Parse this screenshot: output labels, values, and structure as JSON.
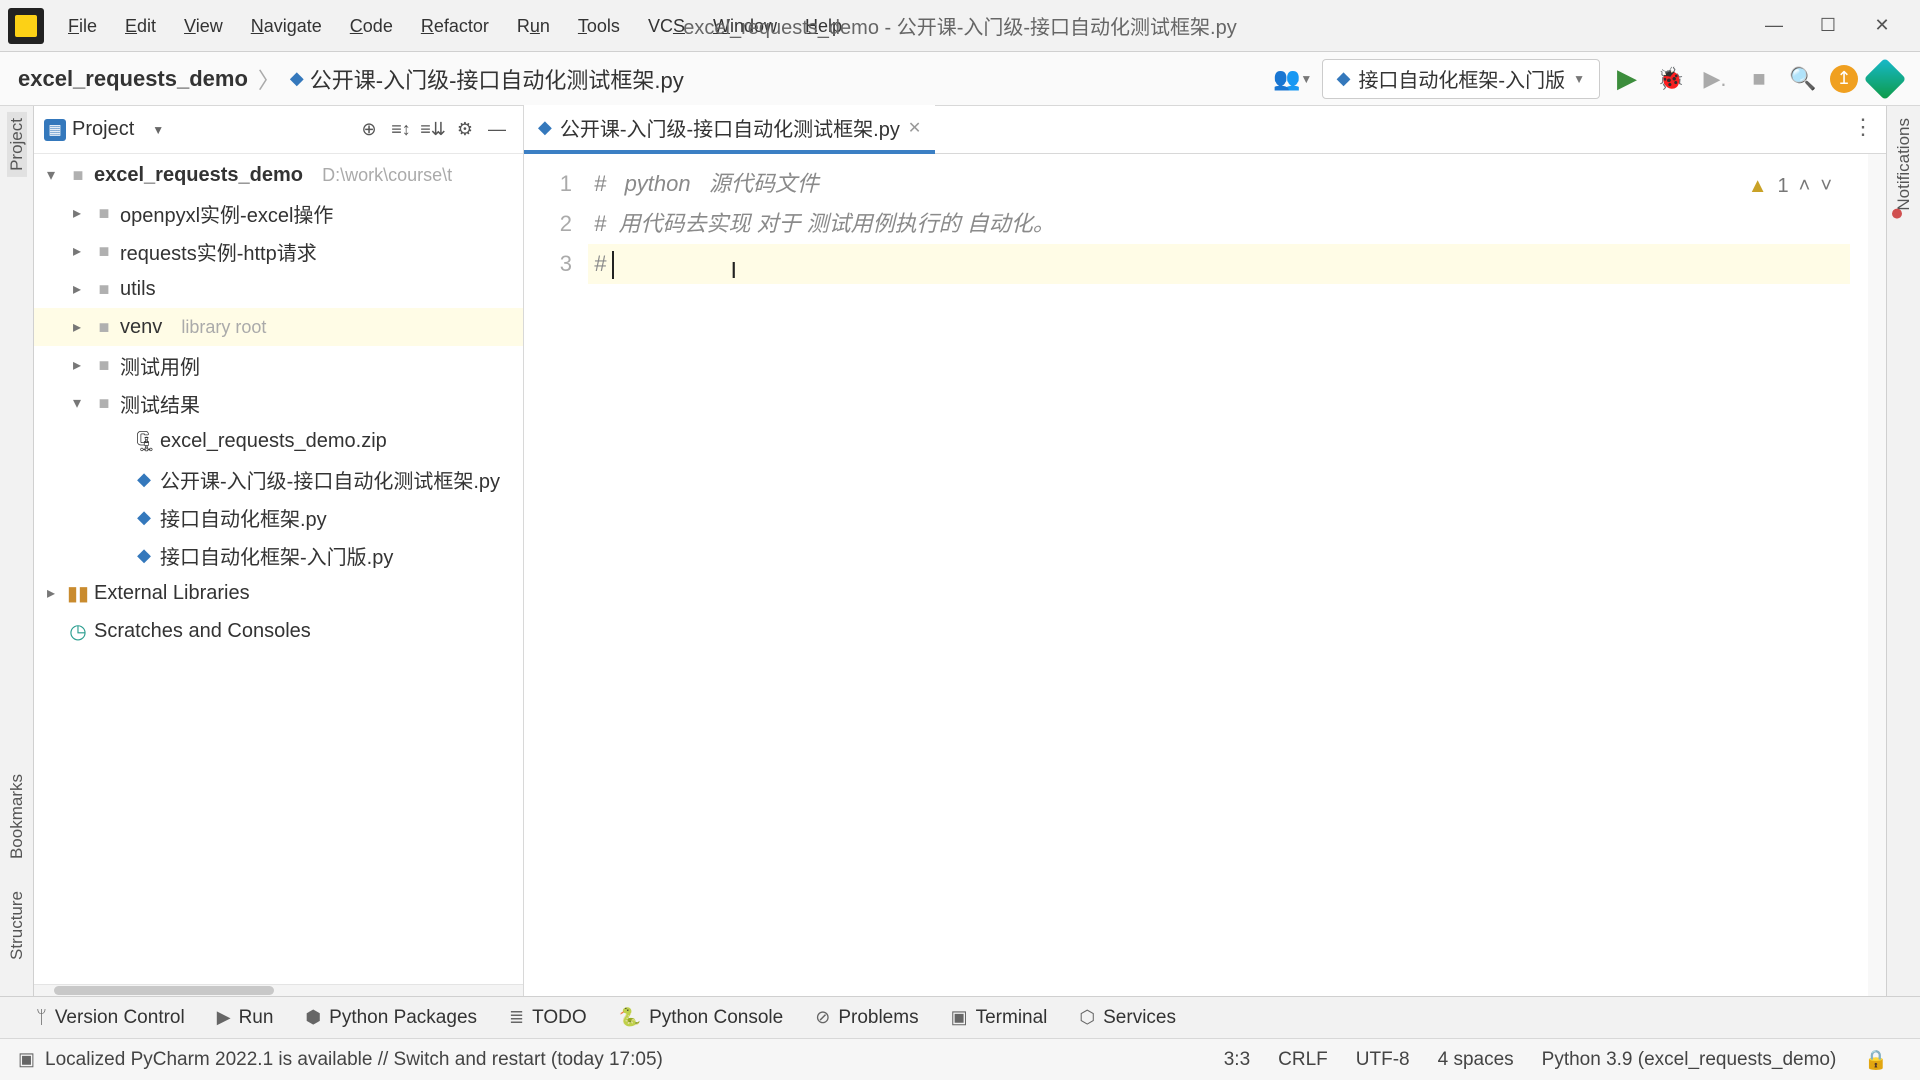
{
  "window_title": "excel_requests_demo - 公开课-入门级-接口自动化测试框架.py",
  "menu": {
    "file": "File",
    "edit": "Edit",
    "view": "View",
    "navigate": "Navigate",
    "code": "Code",
    "refactor": "Refactor",
    "run": "Run",
    "tools": "Tools",
    "vcs": "VCS",
    "window": "Window",
    "help": "Help"
  },
  "breadcrumb": {
    "root": "excel_requests_demo",
    "file": "公开课-入门级-接口自动化测试框架.py"
  },
  "run_config": "接口自动化框架-入门版",
  "left_rail": {
    "project": "Project",
    "bookmarks": "Bookmarks",
    "structure": "Structure"
  },
  "right_rail": {
    "notifications": "Notifications"
  },
  "project_panel": {
    "title": "Project"
  },
  "tree": {
    "root": "excel_requests_demo",
    "root_path": "D:\\work\\course\\t",
    "items": [
      {
        "label": "openpyxl实例-excel操作",
        "kind": "dir",
        "expand": false
      },
      {
        "label": "requests实例-http请求",
        "kind": "dir",
        "expand": false
      },
      {
        "label": "utils",
        "kind": "dir",
        "expand": false
      },
      {
        "label": "venv",
        "trail": "library root",
        "kind": "dir",
        "expand": false,
        "sel": true
      },
      {
        "label": "测试用例",
        "kind": "dir",
        "expand": false
      },
      {
        "label": "测试结果",
        "kind": "dir",
        "expand": true
      },
      {
        "label": "excel_requests_demo.zip",
        "kind": "zip",
        "depth": 2
      },
      {
        "label": "公开课-入门级-接口自动化测试框架.py",
        "kind": "py",
        "depth": 2
      },
      {
        "label": "接口自动化框架.py",
        "kind": "py",
        "depth": 2
      },
      {
        "label": "接口自动化框架-入门版.py",
        "kind": "py",
        "depth": 2
      }
    ],
    "ext_lib": "External Libraries",
    "scratches": "Scratches and Consoles"
  },
  "tab": {
    "name": "公开课-入门级-接口自动化测试框架.py"
  },
  "editor": {
    "gutter": [
      "1",
      "2",
      "3"
    ],
    "lines": [
      "#   python   源代码文件",
      "#  用代码去实现 对于 测试用例执行的 自动化。",
      "# "
    ],
    "warnings": "1"
  },
  "bottom": {
    "vc": "Version Control",
    "run": "Run",
    "pkg": "Python Packages",
    "todo": "TODO",
    "console": "Python Console",
    "problems": "Problems",
    "terminal": "Terminal",
    "services": "Services"
  },
  "status": {
    "msg": "Localized PyCharm 2022.1 is available // Switch and restart (today 17:05)",
    "pos": "3:3",
    "eol": "CRLF",
    "enc": "UTF-8",
    "indent": "4 spaces",
    "interpreter": "Python 3.9 (excel_requests_demo)"
  }
}
